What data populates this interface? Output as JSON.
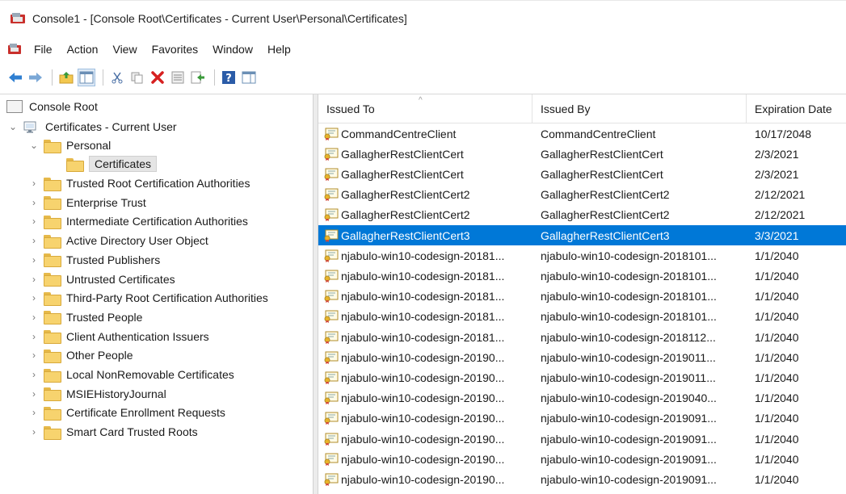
{
  "window": {
    "title": "Console1 - [Console Root\\Certificates - Current User\\Personal\\Certificates]"
  },
  "menu": [
    "File",
    "Action",
    "View",
    "Favorites",
    "Window",
    "Help"
  ],
  "toolbar": {
    "buttons": [
      "back-arrow-icon",
      "forward-arrow-icon",
      "up-folder-icon",
      "show-hide-tree-icon",
      "cut-icon",
      "copy-icon",
      "delete-icon",
      "properties-icon",
      "export-list-icon",
      "help-icon",
      "action-pane-icon"
    ]
  },
  "tree": {
    "root": "Console Root",
    "store": "Certificates - Current User",
    "personal": "Personal",
    "selected": "Certificates",
    "folders": [
      "Trusted Root Certification Authorities",
      "Enterprise Trust",
      "Intermediate Certification Authorities",
      "Active Directory User Object",
      "Trusted Publishers",
      "Untrusted Certificates",
      "Third-Party Root Certification Authorities",
      "Trusted People",
      "Client Authentication Issuers",
      "Other People",
      "Local NonRemovable Certificates",
      "MSIEHistoryJournal",
      "Certificate Enrollment Requests",
      "Smart Card Trusted Roots"
    ]
  },
  "list": {
    "columns": [
      "Issued To",
      "Issued By",
      "Expiration Date"
    ],
    "selected_index": 5,
    "rows": [
      [
        "CommandCentreClient",
        "CommandCentreClient",
        "10/17/2048"
      ],
      [
        "GallagherRestClientCert",
        "GallagherRestClientCert",
        "2/3/2021"
      ],
      [
        "GallagherRestClientCert",
        "GallagherRestClientCert",
        "2/3/2021"
      ],
      [
        "GallagherRestClientCert2",
        "GallagherRestClientCert2",
        "2/12/2021"
      ],
      [
        "GallagherRestClientCert2",
        "GallagherRestClientCert2",
        "2/12/2021"
      ],
      [
        "GallagherRestClientCert3",
        "GallagherRestClientCert3",
        "3/3/2021"
      ],
      [
        "njabulo-win10-codesign-20181...",
        "njabulo-win10-codesign-2018101...",
        "1/1/2040"
      ],
      [
        "njabulo-win10-codesign-20181...",
        "njabulo-win10-codesign-2018101...",
        "1/1/2040"
      ],
      [
        "njabulo-win10-codesign-20181...",
        "njabulo-win10-codesign-2018101...",
        "1/1/2040"
      ],
      [
        "njabulo-win10-codesign-20181...",
        "njabulo-win10-codesign-2018101...",
        "1/1/2040"
      ],
      [
        "njabulo-win10-codesign-20181...",
        "njabulo-win10-codesign-2018112...",
        "1/1/2040"
      ],
      [
        "njabulo-win10-codesign-20190...",
        "njabulo-win10-codesign-2019011...",
        "1/1/2040"
      ],
      [
        "njabulo-win10-codesign-20190...",
        "njabulo-win10-codesign-2019011...",
        "1/1/2040"
      ],
      [
        "njabulo-win10-codesign-20190...",
        "njabulo-win10-codesign-2019040...",
        "1/1/2040"
      ],
      [
        "njabulo-win10-codesign-20190...",
        "njabulo-win10-codesign-2019091...",
        "1/1/2040"
      ],
      [
        "njabulo-win10-codesign-20190...",
        "njabulo-win10-codesign-2019091...",
        "1/1/2040"
      ],
      [
        "njabulo-win10-codesign-20190...",
        "njabulo-win10-codesign-2019091...",
        "1/1/2040"
      ],
      [
        "njabulo-win10-codesign-20190...",
        "njabulo-win10-codesign-2019091...",
        "1/1/2040"
      ]
    ]
  },
  "colors": {
    "selection": "#0078d7",
    "folder": "#f7d36e"
  }
}
